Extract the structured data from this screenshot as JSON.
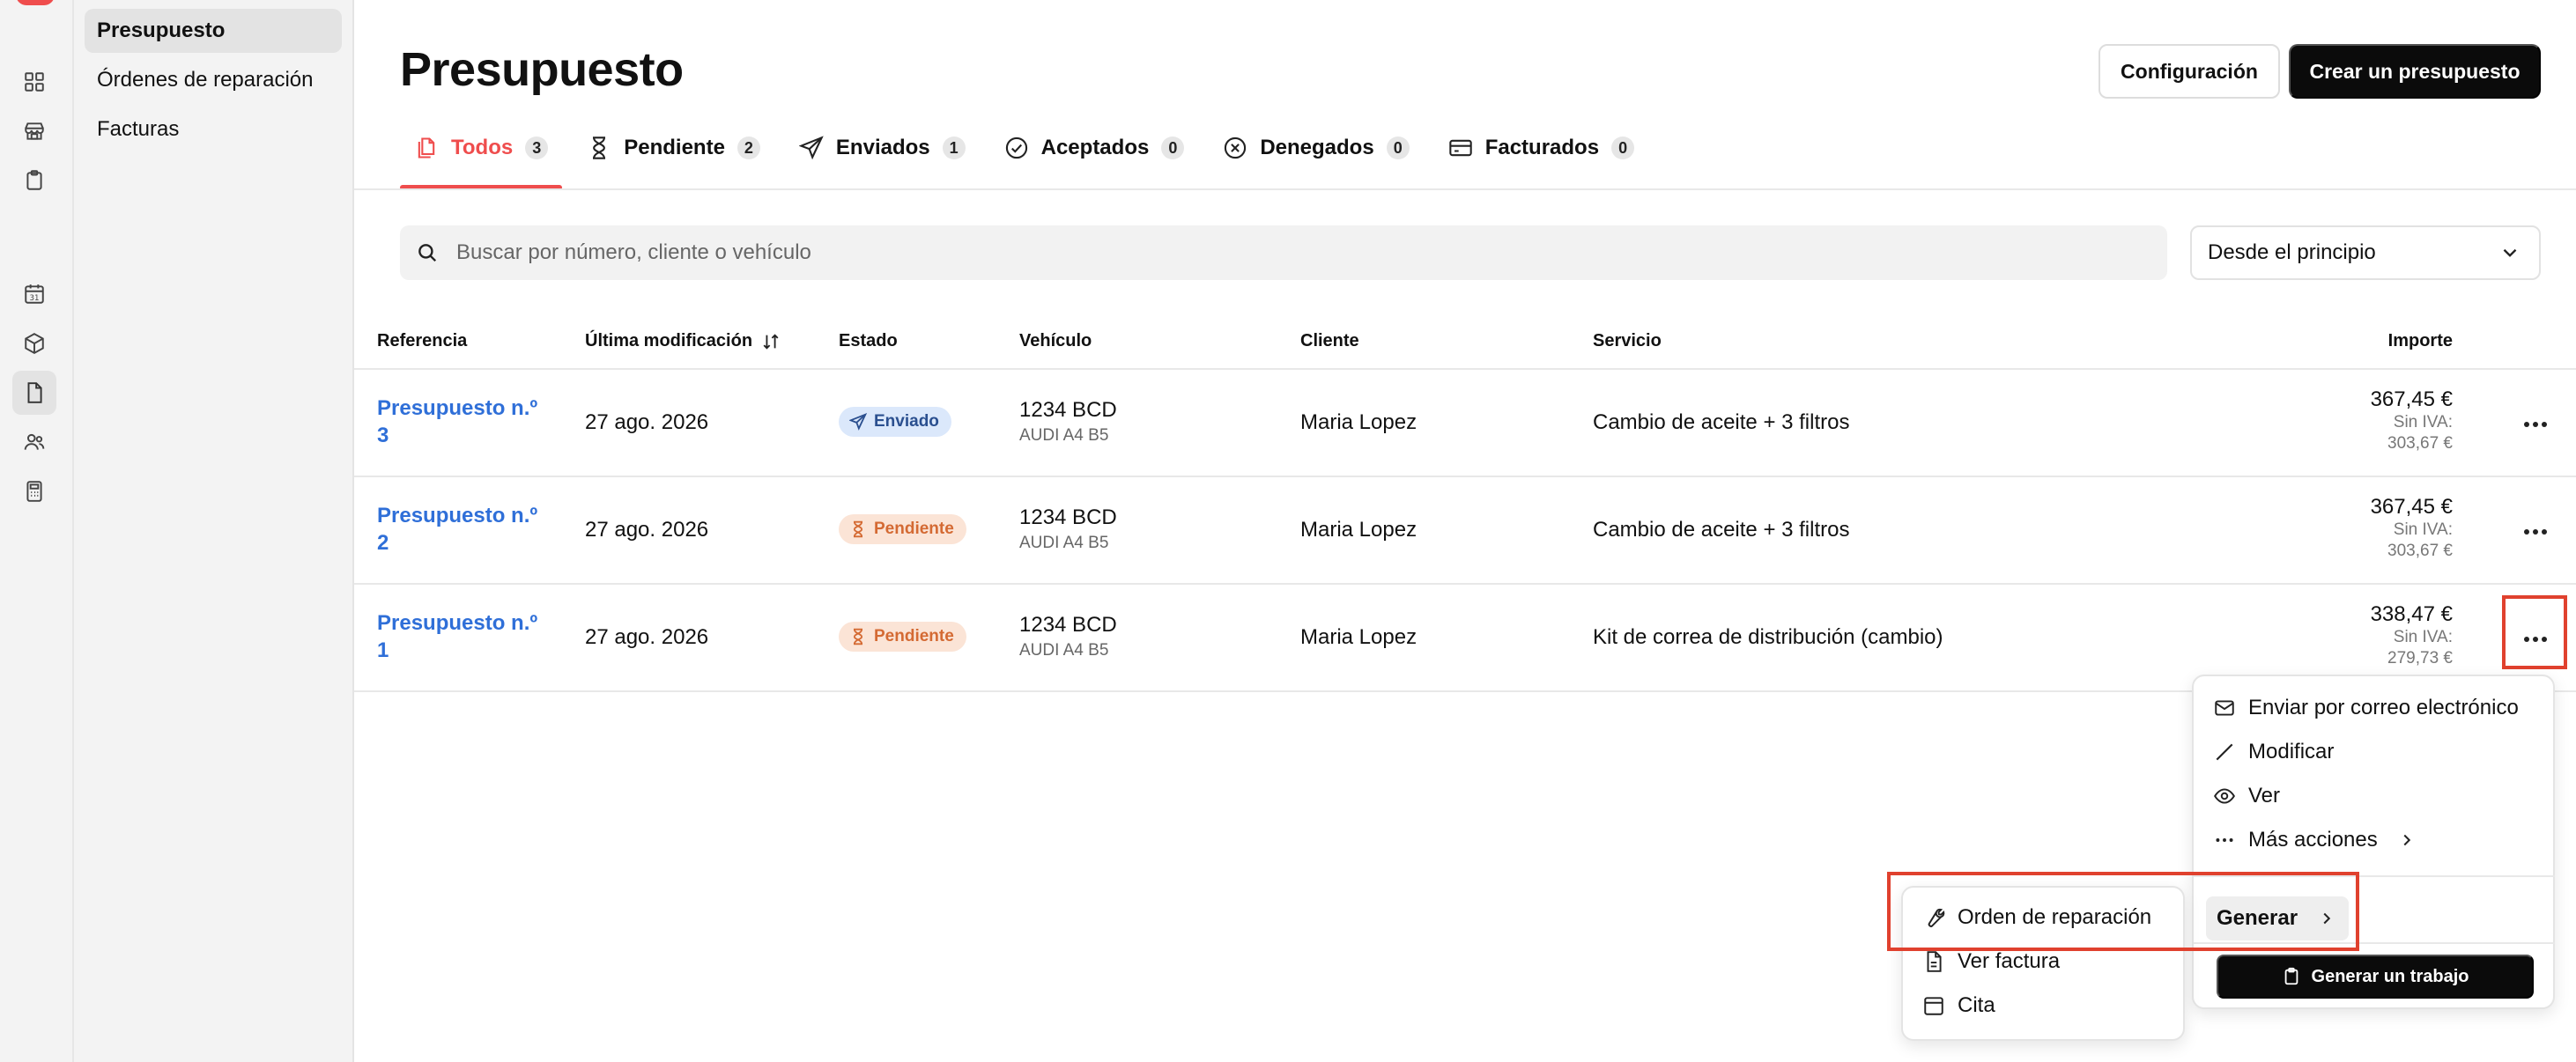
{
  "sidebar": {
    "items": [
      {
        "label": "Presupuesto",
        "active": true
      },
      {
        "label": "Órdenes de reparación",
        "active": false
      },
      {
        "label": "Facturas",
        "active": false
      }
    ]
  },
  "rail": {
    "icons": [
      "grid-icon",
      "store-icon",
      "clipboard-icon",
      "calendar-icon",
      "box-icon",
      "document-icon",
      "users-icon",
      "calculator-icon"
    ],
    "calendar_day": "31"
  },
  "header": {
    "title": "Presupuesto",
    "config_label": "Configuración",
    "create_label": "Crear un presupuesto"
  },
  "tabs": [
    {
      "label": "Todos",
      "count": "3",
      "active": true
    },
    {
      "label": "Pendiente",
      "count": "2"
    },
    {
      "label": "Enviados",
      "count": "1"
    },
    {
      "label": "Aceptados",
      "count": "0"
    },
    {
      "label": "Denegados",
      "count": "0"
    },
    {
      "label": "Facturados",
      "count": "0"
    }
  ],
  "search": {
    "placeholder": "Buscar por número, cliente o vehículo",
    "value": ""
  },
  "filter": {
    "selected": "Desde el principio"
  },
  "table": {
    "headers": {
      "ref": "Referencia",
      "date": "Última modificación",
      "estado": "Estado",
      "vehiculo": "Vehículo",
      "cliente": "Cliente",
      "servicio": "Servicio",
      "importe": "Importe"
    },
    "rows": [
      {
        "ref": "Presupuesto n.º 3",
        "date": "27 ago. 2026",
        "estado": "Enviado",
        "estado_kind": "sent",
        "plate": "1234 BCD",
        "model": "AUDI A4 B5",
        "cliente": "Maria Lopez",
        "servicio": "Cambio de aceite + 3 filtros",
        "total": "367,45 €",
        "sin_iva_label": "Sin IVA:",
        "sin_iva": "303,67 €"
      },
      {
        "ref": "Presupuesto n.º 2",
        "date": "27 ago. 2026",
        "estado": "Pendiente",
        "estado_kind": "pending",
        "plate": "1234 BCD",
        "model": "AUDI A4 B5",
        "cliente": "Maria Lopez",
        "servicio": "Cambio de aceite + 3 filtros",
        "total": "367,45 €",
        "sin_iva_label": "Sin IVA:",
        "sin_iva": "303,67 €"
      },
      {
        "ref": "Presupuesto n.º 1",
        "date": "27 ago. 2026",
        "estado": "Pendiente",
        "estado_kind": "pending",
        "plate": "1234 BCD",
        "model": "AUDI A4 B5",
        "cliente": "Maria Lopez",
        "servicio": "Kit de correa de distribución (cambio)",
        "total": "338,47 €",
        "sin_iva_label": "Sin IVA:",
        "sin_iva": "279,73 €"
      }
    ]
  },
  "actions_menu": {
    "email": "Enviar por correo electrónico",
    "edit": "Modificar",
    "view": "Ver",
    "more": "Más acciones",
    "generate": "Generar",
    "generate_job": "Generar un trabajo"
  },
  "generate_submenu": {
    "repair_order": "Orden de reparación",
    "invoice": "Ver factura",
    "appointment": "Cita"
  },
  "colors": {
    "accent": "#ef4d4d",
    "link": "#2f6fd8",
    "highlight": "#e0412e"
  }
}
